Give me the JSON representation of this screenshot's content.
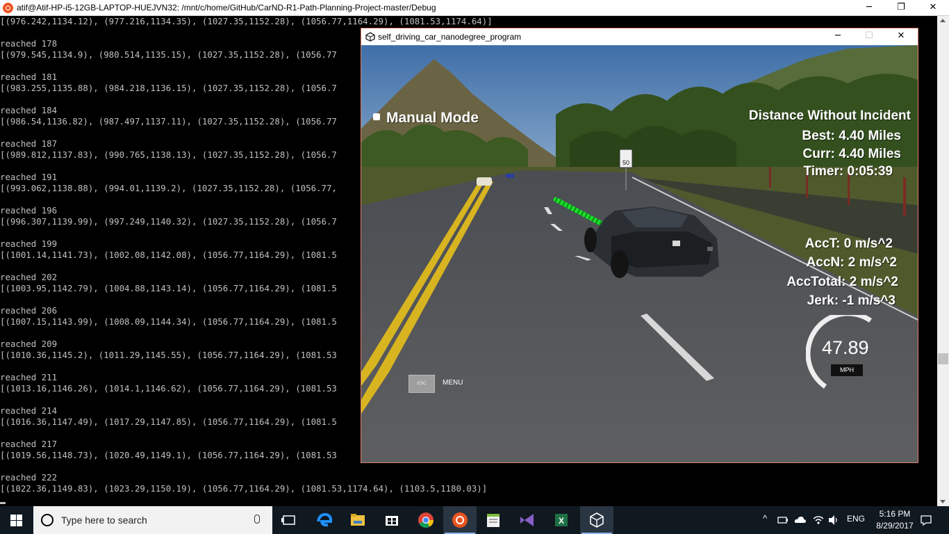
{
  "terminal": {
    "title": "atif@Atif-HP-i5-12GB-LAPTOP-HUEJVN32: /mnt/c/home/GitHub/CarND-R1-Path-Planning-Project-master/Debug",
    "lines": [
      "[(976.242,1134.12), (977.216,1134.35), (1027.35,1152.28), (1056.77,1164.29), (1081.53,1174.64)]",
      "",
      "reached 178",
      "[(979.545,1134.9), (980.514,1135.15), (1027.35,1152.28), (1056.77",
      "",
      "reached 181",
      "[(983.255,1135.88), (984.218,1136.15), (1027.35,1152.28), (1056.7",
      "",
      "reached 184",
      "[(986.54,1136.82), (987.497,1137.11), (1027.35,1152.28), (1056.77",
      "",
      "reached 187",
      "[(989.812,1137.83), (990.765,1138.13), (1027.35,1152.28), (1056.7",
      "",
      "reached 191",
      "[(993.062,1138.88), (994.01,1139.2), (1027.35,1152.28), (1056.77,",
      "",
      "reached 196",
      "[(996.307,1139.99), (997.249,1140.32), (1027.35,1152.28), (1056.7",
      "",
      "reached 199",
      "[(1001.14,1141.73), (1002.08,1142.08), (1056.77,1164.29), (1081.5",
      "",
      "reached 202",
      "[(1003.95,1142.79), (1004.88,1143.14), (1056.77,1164.29), (1081.5",
      "",
      "reached 206",
      "[(1007.15,1143.99), (1008.09,1144.34), (1056.77,1164.29), (1081.5",
      "",
      "reached 209",
      "[(1010.36,1145.2), (1011.29,1145.55), (1056.77,1164.29), (1081.53",
      "",
      "reached 211",
      "[(1013.16,1146.26), (1014.1,1146.62), (1056.77,1164.29), (1081.53",
      "",
      "reached 214",
      "[(1016.36,1147.49), (1017.29,1147.85), (1056.77,1164.29), (1081.5",
      "",
      "reached 217",
      "[(1019.56,1148.73), (1020.49,1149.1), (1056.77,1164.29), (1081.53",
      "",
      "reached 222",
      "[(1022.36,1149.83), (1023.29,1150.19), (1056.77,1164.29), (1081.53,1174.64), (1103.5,1180.03)]"
    ]
  },
  "window_controls": {
    "minimize": "─",
    "restore": "❐",
    "close": "✕",
    "maximize": "☐"
  },
  "simulator": {
    "title": "self_driving_car_nanodegree_program",
    "mode_label": "Manual Mode",
    "distance_heading": "Distance Without Incident",
    "best": "Best: 4.40 Miles",
    "curr": "Curr: 4.40 Miles",
    "timer": "Timer: 0:05:39",
    "acc_t": "AccT: 0 m/s^2",
    "acc_n": "AccN: 2 m/s^2",
    "acc_total": "AccTotal: 2 m/s^2",
    "jerk": "Jerk: -1 m/s^3",
    "speed": "47.89",
    "speed_unit": "MPH",
    "speed_limit_sign": "50",
    "esc_label": "ESC",
    "menu_label": "MENU"
  },
  "taskbar": {
    "search_placeholder": "Type here to search",
    "language": "ENG",
    "time": "5:16 PM",
    "date": "8/29/2017",
    "apps": [
      "task-view",
      "edge",
      "file-explorer",
      "store",
      "chrome",
      "ubuntu",
      "notepad",
      "visual-studio",
      "excel",
      "unity"
    ]
  },
  "colors": {
    "terminal_bg": "#000000",
    "terminal_text": "#c0c0c0",
    "path_green": "#19e02a",
    "taskbar_bg": "#101820",
    "sim_border": "#e08070"
  }
}
